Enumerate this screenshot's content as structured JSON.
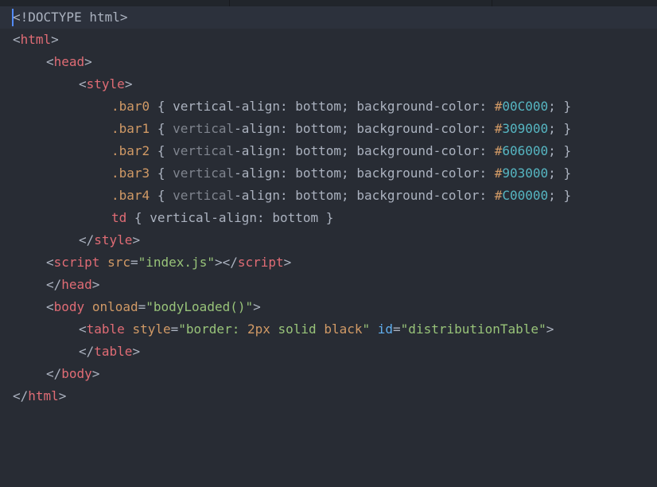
{
  "editor": {
    "lines": [
      {
        "doctype": "<!DOCTYPE html>"
      },
      {
        "open": "<",
        "tag": "html",
        "close": ">"
      },
      {
        "open": "<",
        "tag": "head",
        "close": ">"
      },
      {
        "open": "<",
        "tag": "style",
        "close": ">"
      },
      {
        "selector": ".bar0",
        "brace_open": "{",
        "prop_a": "vertical",
        "prop_b": "-align",
        "colon1": ":",
        "value1": "bottom",
        "semi1": ";",
        "prop2": "background-color",
        "colon2": ":",
        "hash": "#",
        "color": "00C000",
        "semi2": ";",
        "brace_close": "}"
      },
      {
        "selector": ".bar1",
        "brace_open": "{",
        "prop_a": "vertical",
        "prop_b": "-align",
        "colon1": ":",
        "value1": "bottom",
        "semi1": ";",
        "prop2": "background-color",
        "colon2": ":",
        "hash": "#",
        "color": "309000",
        "semi2": ";",
        "brace_close": "}"
      },
      {
        "selector": ".bar2",
        "brace_open": "{",
        "prop_a": "vertical",
        "prop_b": "-align",
        "colon1": ":",
        "value1": "bottom",
        "semi1": ";",
        "prop2": "background-color",
        "colon2": ":",
        "hash": "#",
        "color": "606000",
        "semi2": ";",
        "brace_close": "}"
      },
      {
        "selector": ".bar3",
        "brace_open": "{",
        "prop_a": "vertical",
        "prop_b": "-align",
        "colon1": ":",
        "value1": "bottom",
        "semi1": ";",
        "prop2": "background-color",
        "colon2": ":",
        "hash": "#",
        "color": "903000",
        "semi2": ";",
        "brace_close": "}"
      },
      {
        "selector": ".bar4",
        "brace_open": "{",
        "prop_a": "vertical",
        "prop_b": "-align",
        "colon1": ":",
        "value1": "bottom",
        "semi1": ";",
        "prop2": "background-color",
        "colon2": ":",
        "hash": "#",
        "color": "C00000",
        "semi2": ";",
        "brace_close": "}"
      },
      {
        "selector": "td",
        "brace_open": "{",
        "prop": "vertical-align",
        "colon": ":",
        "value": "bottom",
        "brace_close": "}"
      },
      {
        "open": "</",
        "tag": "style",
        "close": ">"
      },
      {
        "open": "<",
        "tag": "script",
        "attr": "src",
        "eq": "=",
        "str": "\"index.js\"",
        "mid": "></",
        "tag2": "script",
        "close": ">"
      },
      {
        "open": "</",
        "tag": "head",
        "close": ">"
      },
      {
        "open": "<",
        "tag": "body",
        "attr": "onload",
        "eq": "=",
        "str": "\"bodyLoaded()\"",
        "close": ">"
      },
      {
        "open": "<",
        "tag": "table",
        "attr": "style",
        "eq": "=",
        "str_a": "\"border: ",
        "num": "2px",
        "str_b": " solid ",
        "kw": "black",
        "str_c": "\"",
        "attr2": "id",
        "eq2": "=",
        "str2": "\"distributionTable\"",
        "close": ">"
      },
      {
        "open": "</",
        "tag": "table",
        "close": ">"
      },
      {
        "open": "</",
        "tag": "body",
        "close": ">"
      },
      {
        "open": "</",
        "tag": "html",
        "close": ">"
      }
    ]
  },
  "colors": {
    "background": "#282c34",
    "active_line": "#2c313c",
    "cursor": "#528bff",
    "tag": "#e06c75",
    "attribute": "#d19a66",
    "string": "#98c379",
    "hex_value": "#56b6c2",
    "id_attribute": "#61afef",
    "punctuation": "#abb2bf"
  }
}
